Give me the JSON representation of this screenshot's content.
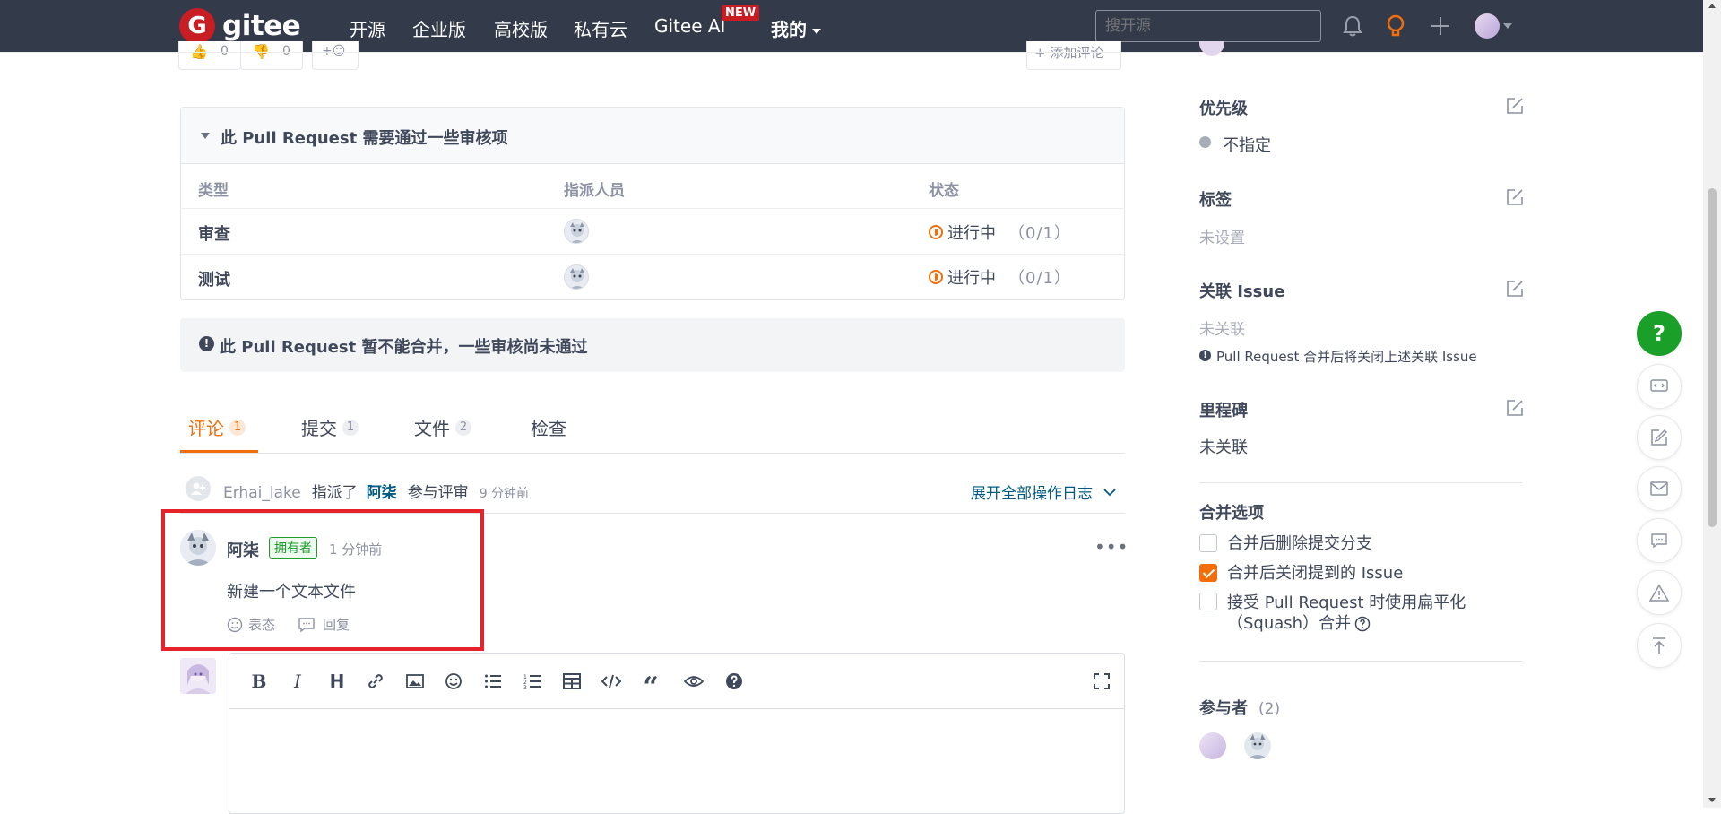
{
  "topnav": {
    "logo_text": "gitee",
    "logo_glyph": "G",
    "links": [
      "开源",
      "企业版",
      "高校版",
      "私有云",
      "Gitee AI",
      "我的"
    ],
    "new_badge": "NEW",
    "search_placeholder": "搜开源"
  },
  "top_partial": {
    "add_comment": "+ 添加评论",
    "thumbs_up_count": "0",
    "thumbs_down_count": "0"
  },
  "review": {
    "title": "此 Pull Request 需要通过一些审核项",
    "columns": [
      "类型",
      "指派人员",
      "状态"
    ],
    "rows": [
      {
        "type": "审查",
        "status": "进行中",
        "count": "（0/1）"
      },
      {
        "type": "测试",
        "status": "进行中",
        "count": "（0/1）"
      }
    ]
  },
  "notice": {
    "text": "此 Pull Request 暂不能合并，一些审核尚未通过"
  },
  "tabs": [
    {
      "label": "评论",
      "count": "1",
      "active": true
    },
    {
      "label": "提交",
      "count": "1"
    },
    {
      "label": "文件",
      "count": "2"
    },
    {
      "label": "检查",
      "count": ""
    }
  ],
  "activity": {
    "user": "Erhai_lake",
    "action": "指派了",
    "target": "阿柒",
    "action_suffix": "参与评审",
    "time": "9 分钟前",
    "expand_label": "展开全部操作日志"
  },
  "comment": {
    "author": "阿柒",
    "role_badge": "拥有者",
    "time": "1 分钟前",
    "body": "新建一个文本文件",
    "react_label": "表态",
    "reply_label": "回复"
  },
  "editor": {
    "toolbar": [
      "B",
      "I",
      "H"
    ]
  },
  "sidebar": {
    "priority_title": "优先级",
    "priority_value": "不指定",
    "labels_title": "标签",
    "labels_value": "未设置",
    "issue_title": "关联 Issue",
    "issue_value": "未关联",
    "issue_note": "Pull Request 合并后将关闭上述关联 Issue",
    "milestone_title": "里程碑",
    "milestone_value": "未关联",
    "merge_title": "合并选项",
    "merge_options": [
      {
        "label": "合并后删除提交分支",
        "checked": false
      },
      {
        "label": "合并后关闭提到的 Issue",
        "checked": true
      },
      {
        "label": "接受 Pull Request 时使用扁平化",
        "label2": "（Squash）合并",
        "checked": false
      }
    ],
    "participants_title": "参与者",
    "participants_count": "(2)"
  },
  "colors": {
    "nav_bg": "#333b4a",
    "accent_orange": "#f26e0a",
    "brand_red": "#c71d23",
    "link_blue": "#005980",
    "help_green": "#1a9f29",
    "highlight_red": "#e6222b"
  }
}
